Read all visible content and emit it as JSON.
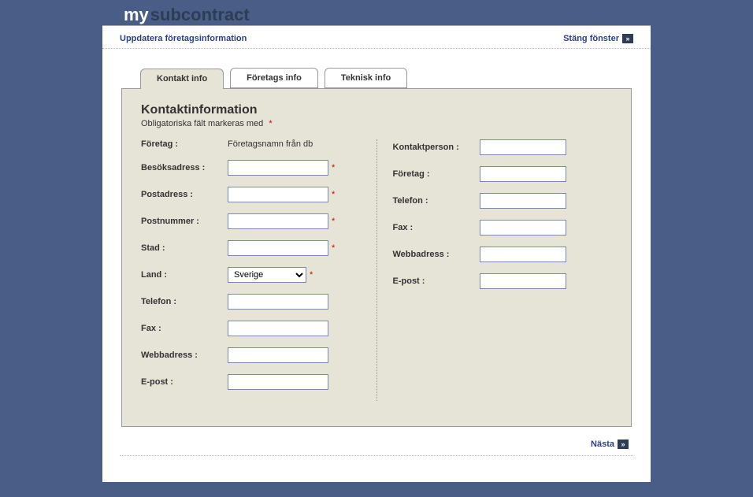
{
  "logo": {
    "prefix": "my",
    "suffix": "subcontract"
  },
  "header": {
    "title": "Uppdatera företagsinformation",
    "close_label": "Stäng fönster"
  },
  "tabs": [
    {
      "label": "Kontakt info",
      "active": true
    },
    {
      "label": "Företags info",
      "active": false
    },
    {
      "label": "Teknisk info",
      "active": false
    }
  ],
  "form": {
    "title": "Kontaktinformation",
    "subtitle_prefix": "Obligatoriska fält markeras med ",
    "asterisk": "*"
  },
  "left": {
    "company_label": "Företag :",
    "company_value": "Företagsnamn från db",
    "visit_label": "Besöksadress :",
    "visit_value": "",
    "post_label": "Postadress :",
    "post_value": "",
    "zip_label": "Postnummer :",
    "zip_value": "",
    "city_label": "Stad :",
    "city_value": "",
    "country_label": "Land :",
    "country_value": "Sverige",
    "phone_label": "Telefon :",
    "phone_value": "",
    "fax_label": "Fax :",
    "fax_value": "",
    "web_label": "Webbadress :",
    "web_value": "",
    "email_label": "E-post :",
    "email_value": ""
  },
  "right": {
    "contact_label": "Kontaktperson :",
    "contact_value": "",
    "company_label": "Företag :",
    "company_value": "",
    "phone_label": "Telefon :",
    "phone_value": "",
    "fax_label": "Fax :",
    "fax_value": "",
    "web_label": "Webbadress :",
    "web_value": "",
    "email_label": "E-post :",
    "email_value": ""
  },
  "footer": {
    "next_label": "Nästa"
  }
}
